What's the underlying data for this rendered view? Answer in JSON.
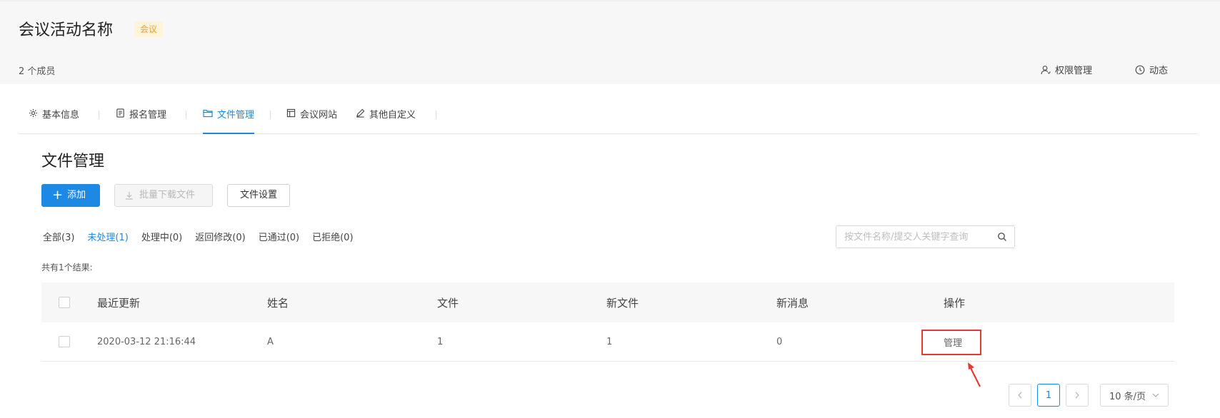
{
  "header": {
    "title": "会议活动名称",
    "tag": "会议",
    "members": "2 个成员",
    "actions": {
      "permissions": "权限管理",
      "activity": "动态"
    }
  },
  "tabs": [
    {
      "label": "基本信息",
      "icon": "gear-icon"
    },
    {
      "label": "报名管理",
      "icon": "form-icon"
    },
    {
      "label": "文件管理",
      "icon": "folder-icon",
      "active": true
    },
    {
      "label": "会议网站",
      "icon": "layout-icon"
    },
    {
      "label": "其他自定义",
      "icon": "pencil-icon"
    }
  ],
  "section_title": "文件管理",
  "toolbar": {
    "add_label": "添加",
    "batch_download_label": "批量下载文件",
    "settings_label": "文件设置"
  },
  "filters": [
    {
      "label": "全部(3)"
    },
    {
      "label": "未处理(1)",
      "active": true
    },
    {
      "label": "处理中(0)"
    },
    {
      "label": "返回修改(0)"
    },
    {
      "label": "已通过(0)"
    },
    {
      "label": "已拒绝(0)"
    }
  ],
  "search": {
    "placeholder": "按文件名称/提交人关键字查询"
  },
  "result_count": "共有1个结果:",
  "table": {
    "columns": [
      "最近更新",
      "姓名",
      "文件",
      "新文件",
      "新消息",
      "操作"
    ],
    "rows": [
      {
        "updated": "2020-03-12 21:16:44",
        "name": "A",
        "files": "1",
        "new_files": "1",
        "new_messages": "0",
        "action": "管理"
      }
    ]
  },
  "pagination": {
    "current_page": "1",
    "page_size": "10 条/页"
  },
  "colors": {
    "accent": "#1e88e5",
    "tag_bg": "#fff3d9",
    "tag_text": "#e6a23c",
    "highlight": "#e53935"
  }
}
